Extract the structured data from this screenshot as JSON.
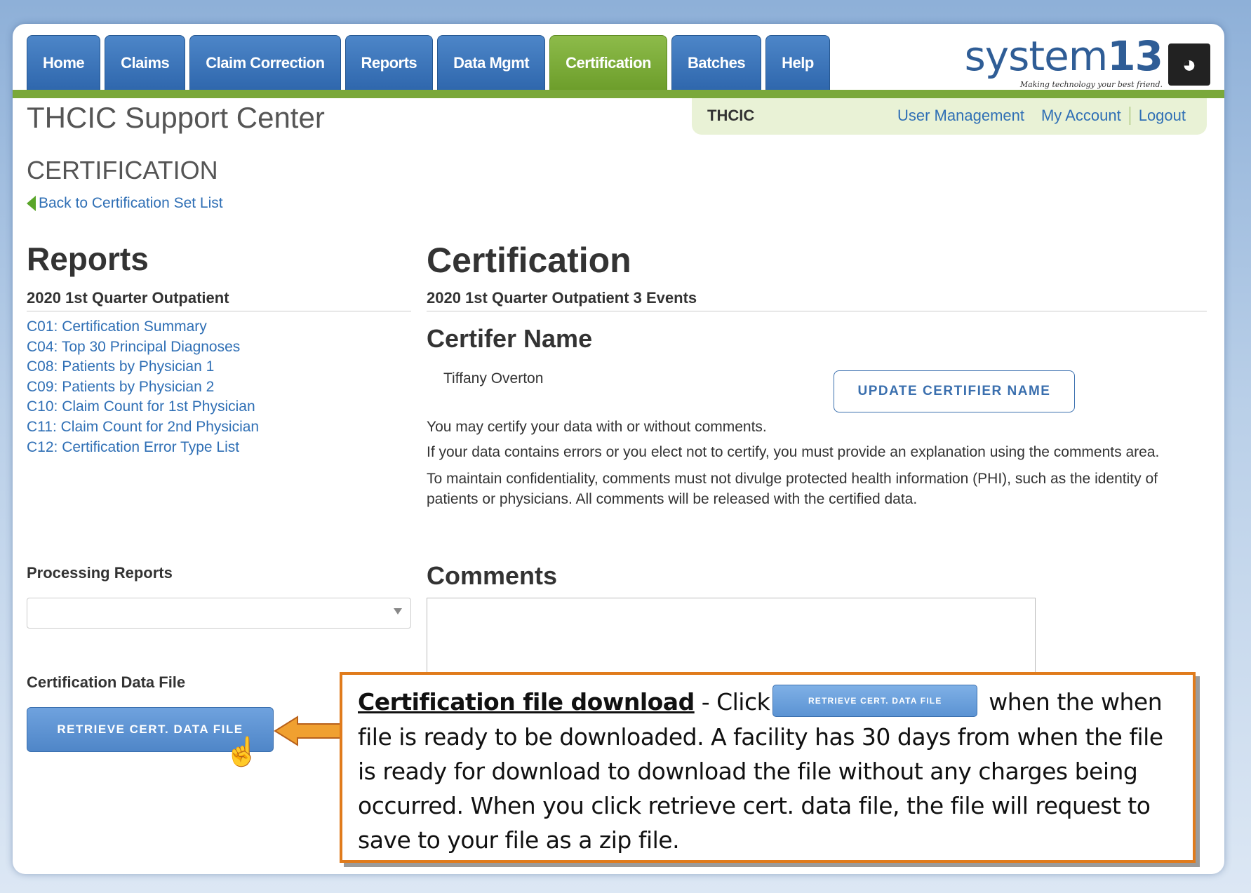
{
  "nav": {
    "tabs": [
      {
        "label": "Home",
        "active": false
      },
      {
        "label": "Claims",
        "active": false
      },
      {
        "label": "Claim Correction",
        "active": false
      },
      {
        "label": "Reports",
        "active": false
      },
      {
        "label": "Data Mgmt",
        "active": false
      },
      {
        "label": "Certification",
        "active": true
      },
      {
        "label": "Batches",
        "active": false
      },
      {
        "label": "Help",
        "active": false
      }
    ]
  },
  "logo": {
    "prefix": "system",
    "number": "13",
    "tagline": "Making technology your best friend.",
    "icon": "dog-icon"
  },
  "userbar": {
    "org": "THCIC",
    "links": [
      "User Management",
      "My Account",
      "Logout"
    ]
  },
  "page": {
    "site_title": "THCIC Support Center",
    "section": "CERTIFICATION",
    "back_link": "Back to Certification Set List"
  },
  "reports": {
    "heading": "Reports",
    "subheading": "2020 1st Quarter Outpatient",
    "items": [
      "C01: Certification Summary",
      "C04: Top 30 Principal Diagnoses",
      "C08: Patients by Physician 1",
      "C09: Patients by Physician 2",
      "C10: Claim Count for 1st Physician",
      "C11: Claim Count for 2nd Physician",
      "C12: Certification Error Type List"
    ],
    "processing_label": "Processing Reports",
    "processing_selected": "",
    "data_file_label": "Certification Data File",
    "retrieve_button": "RETRIEVE CERT. DATA FILE"
  },
  "certification": {
    "heading": "Certification",
    "subheading": "2020 1st Quarter Outpatient 3 Events",
    "certifer_heading": "Certifer Name",
    "certifer_name": "Tiffany Overton",
    "update_button": "UPDATE CERTIFIER NAME",
    "para1": "You may certify your data with or without comments.",
    "para2": "If your data contains errors or you elect not to certify, you must provide an explanation using the comments area.",
    "para3": "To maintain confidentiality, comments must not divulge protected health information (PHI), such as the identity of patients or physicians. All comments will be released with the certified data.",
    "comments_heading": "Comments",
    "comments_value": ""
  },
  "callout": {
    "title": "Certification file download",
    "pre": " - Click",
    "button": "RETRIEVE CERT. DATA FILE",
    "post": " when the when file is ready to be downloaded. A facility has 30 days from when the file is ready for download to download the file without any charges being occurred. When you click retrieve cert. data file, the file will request to save to your file as a zip file."
  },
  "colors": {
    "tab_blue": "#2f67ad",
    "tab_active_green": "#7aa83a",
    "link_blue": "#2f6fb5",
    "callout_orange": "#e07b1c"
  }
}
